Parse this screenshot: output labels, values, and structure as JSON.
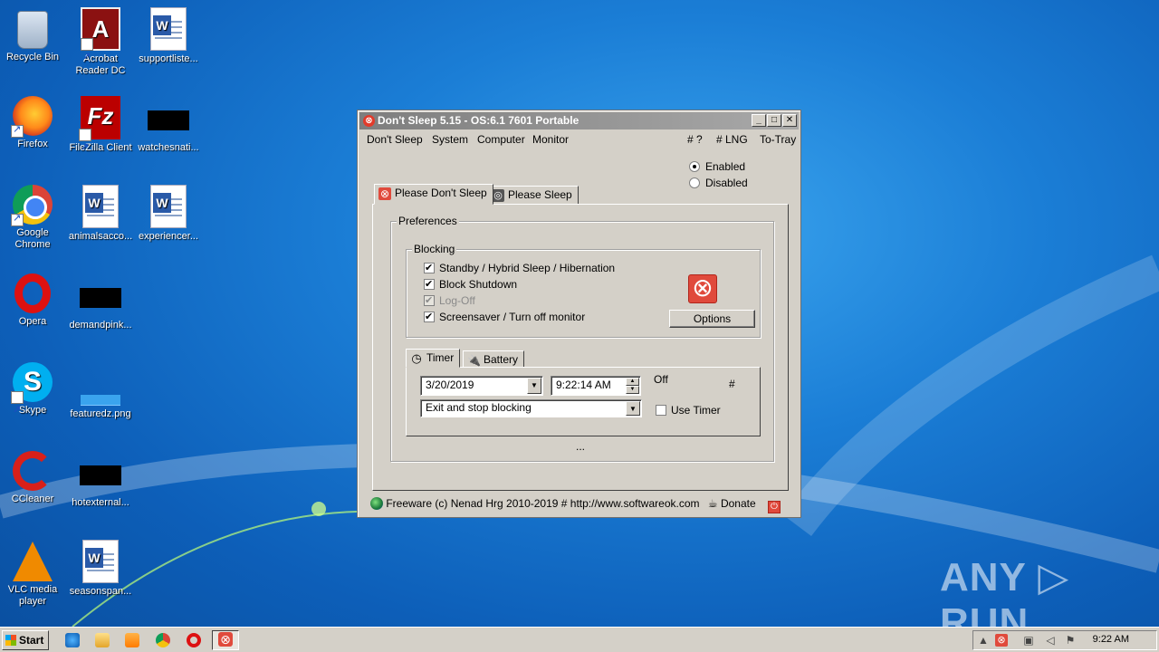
{
  "desktop": {
    "icons": [
      {
        "label": "Recycle Bin"
      },
      {
        "label": "Acrobat Reader DC"
      },
      {
        "label": "supportliste..."
      },
      {
        "label": "Firefox"
      },
      {
        "label": "FileZilla Client"
      },
      {
        "label": "watchesnati..."
      },
      {
        "label": "Google Chrome"
      },
      {
        "label": "animalsacco..."
      },
      {
        "label": "experiencer..."
      },
      {
        "label": "Opera"
      },
      {
        "label": "demandpink..."
      },
      {
        "label": "Skype"
      },
      {
        "label": "featuredz.png"
      },
      {
        "label": "CCleaner"
      },
      {
        "label": "hotexternal..."
      },
      {
        "label": "VLC media player"
      },
      {
        "label": "seasonspan..."
      }
    ],
    "watermark": "ANY ▷ RUN"
  },
  "window": {
    "title": "Don't Sleep 5.15 - OS:6.1 7601 Portable",
    "controls": {
      "minimize": "_",
      "maximize": "□",
      "close": "✕"
    },
    "menu": {
      "dont_sleep": "Don't Sleep",
      "system": "System",
      "computer": "Computer",
      "monitor": "Monitor",
      "help": "# ?",
      "lng": "# LNG",
      "to_tray": "To-Tray"
    },
    "mode": {
      "enabled": "Enabled",
      "disabled": "Disabled",
      "selected": "Enabled"
    },
    "tabs": {
      "please_dont_sleep": "Please Don't Sleep",
      "please_sleep": "Please Sleep"
    },
    "preferences_label": "Preferences",
    "blocking": {
      "label": "Blocking",
      "standby": "Standby / Hybrid Sleep / Hibernation",
      "shutdown": "Block Shutdown",
      "logoff": "Log-Off",
      "screensaver": "Screensaver / Turn off monitor",
      "options_button": "Options"
    },
    "subtabs": {
      "timer": "Timer",
      "battery": "Battery"
    },
    "timer": {
      "date": "3/20/2019",
      "time": "9:22:14 AM",
      "status": "Off",
      "hash": "#",
      "action": "Exit and stop blocking",
      "use_timer": "Use Timer",
      "ellipsis": "..."
    },
    "footer": {
      "text": "Freeware (c) Nenad Hrg 2010-2019 # http://www.softwareok.com",
      "donate": "Donate"
    }
  },
  "taskbar": {
    "start": "Start",
    "clock": "9:22 AM"
  }
}
